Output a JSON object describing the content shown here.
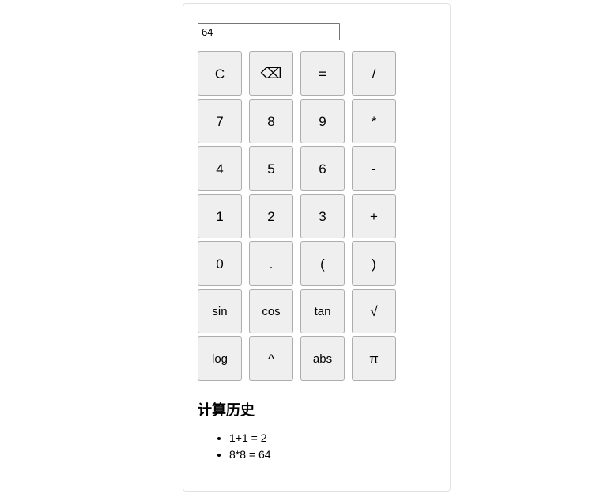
{
  "display": {
    "value": "64",
    "placeholder": ""
  },
  "keypad": {
    "rows": [
      [
        {
          "label": "C",
          "name": "key-clear",
          "size": "normal"
        },
        {
          "label": "⌫",
          "name": "backspace-icon",
          "size": "large"
        },
        {
          "label": "=",
          "name": "key-equals",
          "size": "normal"
        },
        {
          "label": "/",
          "name": "key-divide",
          "size": "normal"
        }
      ],
      [
        {
          "label": "7",
          "name": "key-7",
          "size": "normal"
        },
        {
          "label": "8",
          "name": "key-8",
          "size": "normal"
        },
        {
          "label": "9",
          "name": "key-9",
          "size": "normal"
        },
        {
          "label": "*",
          "name": "key-multiply",
          "size": "normal"
        }
      ],
      [
        {
          "label": "4",
          "name": "key-4",
          "size": "normal"
        },
        {
          "label": "5",
          "name": "key-5",
          "size": "normal"
        },
        {
          "label": "6",
          "name": "key-6",
          "size": "normal"
        },
        {
          "label": "-",
          "name": "key-subtract",
          "size": "normal"
        }
      ],
      [
        {
          "label": "1",
          "name": "key-1",
          "size": "normal"
        },
        {
          "label": "2",
          "name": "key-2",
          "size": "normal"
        },
        {
          "label": "3",
          "name": "key-3",
          "size": "normal"
        },
        {
          "label": "+",
          "name": "key-add",
          "size": "normal"
        }
      ],
      [
        {
          "label": "0",
          "name": "key-0",
          "size": "normal"
        },
        {
          "label": ".",
          "name": "key-decimal",
          "size": "normal"
        },
        {
          "label": "(",
          "name": "key-paren-open",
          "size": "normal"
        },
        {
          "label": ")",
          "name": "key-paren-close",
          "size": "normal"
        }
      ],
      [
        {
          "label": "sin",
          "name": "key-sin",
          "size": "small"
        },
        {
          "label": "cos",
          "name": "key-cos",
          "size": "small"
        },
        {
          "label": "tan",
          "name": "key-tan",
          "size": "small"
        },
        {
          "label": "√",
          "name": "key-sqrt",
          "size": "normal"
        }
      ],
      [
        {
          "label": "log",
          "name": "key-log",
          "size": "small"
        },
        {
          "label": "^",
          "name": "key-power",
          "size": "normal"
        },
        {
          "label": "abs",
          "name": "key-abs",
          "size": "small"
        },
        {
          "label": "π",
          "name": "key-pi",
          "size": "normal"
        }
      ]
    ]
  },
  "history": {
    "title": "计算历史",
    "items": [
      "1+1 = 2",
      "8*8 = 64"
    ]
  },
  "colors": {
    "panel_border": "#e2e2e2",
    "key_face": "#efefef",
    "key_border": "#adadad",
    "input_border": "#767676",
    "page_background": "#ffffff",
    "text": "#000000"
  }
}
